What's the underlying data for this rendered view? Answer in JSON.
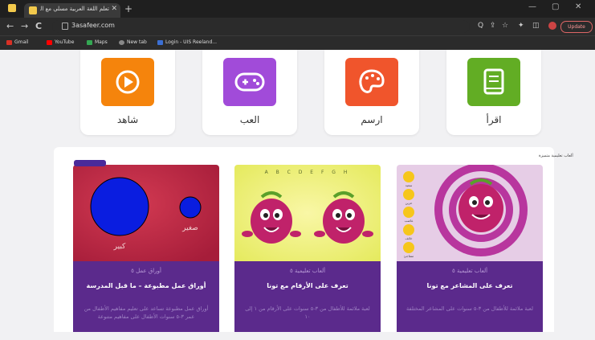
{
  "browser": {
    "tab_title": "تعلم اللغة العربية مسلي مع الصغار",
    "tab_close": "✕",
    "new_tab": "+",
    "nav_back": "←",
    "nav_forward": "→",
    "nav_reload": "C",
    "url": "3asafeer.com",
    "update_label": "Update",
    "window_minimize": "—",
    "window_maximize": "▢",
    "window_close": "✕",
    "toolbar_icons": [
      "Q",
      "⇪",
      "☆",
      "✦",
      "◫"
    ],
    "bookmarks": [
      {
        "label": "Gmail",
        "color": "#d93025"
      },
      {
        "label": "YouTube",
        "color": "#ff0000"
      },
      {
        "label": "Maps",
        "color": "#34a853"
      },
      {
        "label": "New tab",
        "color": "#888888"
      },
      {
        "label": "Login - UIS Reeland...",
        "color": "#3b6fd4"
      }
    ]
  },
  "categories": [
    {
      "label": "شاهد",
      "icon": "play-icon",
      "color": "#f5840c"
    },
    {
      "label": "العب",
      "icon": "gamepad-icon",
      "color": "#a14bd9"
    },
    {
      "label": "ارسم",
      "icon": "palette-icon",
      "color": "#f0552c"
    },
    {
      "label": "اقرأ",
      "icon": "book-icon",
      "color": "#62ad24"
    }
  ],
  "section": {
    "label": "ألعاب تعليمية متميزة"
  },
  "cards": [
    {
      "image_big_label": "كبير",
      "image_small_label": "صغير",
      "category": "أوراق عمل ٥",
      "title": "أوراق عمل مطبوعة – ما قبل المدرسة",
      "description": "أوراق عمل مطبوعة تساعد على تعليم مفاهيم الأطفال من عمر ٣-٥ سنوات الأطفال على مفاهيم متنوعة"
    },
    {
      "image_letters": "A B C D E F G H",
      "category": "ألعاب تعليمية ٥",
      "title": "تعرف على الأرقام مع تونا",
      "description": "لعبة ملائمة للأطفال من ٣-٥ سنوات على الأرقام من ١ إلى ١٠"
    },
    {
      "image_emotions": [
        "سعيد",
        "حزين",
        "غاضب",
        "خائف",
        "متفاجئ"
      ],
      "category": "ألعاب تعليمية ٥",
      "title": "تعرف على المشاعر مع تونا",
      "description": "لعبة ملائمة للأطفال من ٣-٥ سنوات على المشاعر المختلفة"
    }
  ]
}
